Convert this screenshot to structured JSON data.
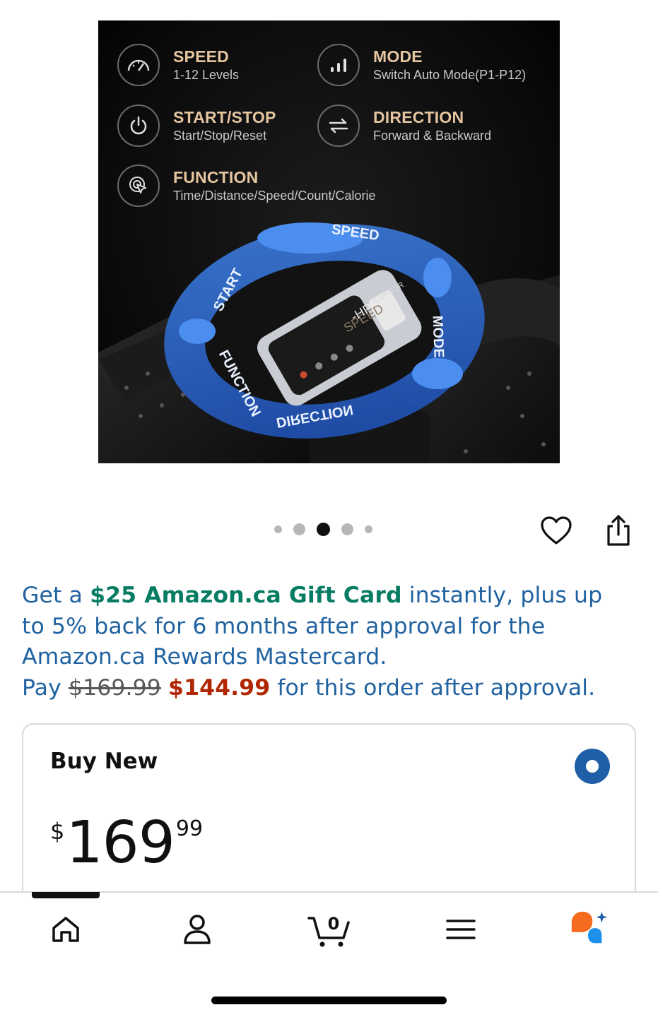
{
  "product_image": {
    "features": [
      {
        "icon": "speedometer-icon",
        "title": "SPEED",
        "subtitle": "1-12 Levels"
      },
      {
        "icon": "bars-icon",
        "title": "MODE",
        "subtitle": "Switch Auto Mode(P1-P12)"
      },
      {
        "icon": "power-icon",
        "title": "START/STOP",
        "subtitle": "Start/Stop/Reset"
      },
      {
        "icon": "arrows-swap-icon",
        "title": "DIRECTION",
        "subtitle": "Forward & Backward"
      },
      {
        "icon": "cursor-click-icon",
        "title": "FUNCTION",
        "subtitle": "Time/Distance/Speed/Count/Calorie"
      }
    ],
    "ring_labels": {
      "speed": "SPEED",
      "start": "START",
      "mode": "MODE",
      "function": "FUNCTION",
      "direction": "DIRECTION"
    },
    "remote": {
      "brand": "CURSOR",
      "speed_text": "SPEED",
      "readout": "-HP-"
    }
  },
  "carousel": {
    "count": 5,
    "active_index": 2
  },
  "actions": {
    "wishlist_icon": "heart-icon",
    "share_icon": "share-icon"
  },
  "promo": {
    "pre": "Get a ",
    "gift_card": "$25 Amazon.ca Gift Card",
    "mid": " instantly, plus up to 5% back for 6 months after approval for the Amazon.ca Rewards Mastercard.",
    "pay_label": "Pay ",
    "old_price": "$169.99",
    "new_price": "$144.99",
    "post": " for this order after approval."
  },
  "buy_box": {
    "title": "Buy New",
    "selected": true,
    "price": {
      "symbol": "$",
      "whole": "169",
      "fraction": "99"
    }
  },
  "bottom_nav": {
    "items": [
      {
        "name": "home",
        "icon": "home-icon"
      },
      {
        "name": "account",
        "icon": "person-icon"
      },
      {
        "name": "cart",
        "icon": "cart-icon",
        "count": "0"
      },
      {
        "name": "menu",
        "icon": "hamburger-icon"
      },
      {
        "name": "rufus",
        "icon": "rufus-assistant-icon"
      }
    ],
    "active_index": 0
  },
  "colors": {
    "link_blue": "#2162A1",
    "promo_green": "#067D62",
    "price_red": "#B12704",
    "radio_blue": "#1F5FA8",
    "feature_title": "#e5c5a0",
    "rufus_orange": "#F56B1F",
    "rufus_blue": "#1E90E8"
  }
}
